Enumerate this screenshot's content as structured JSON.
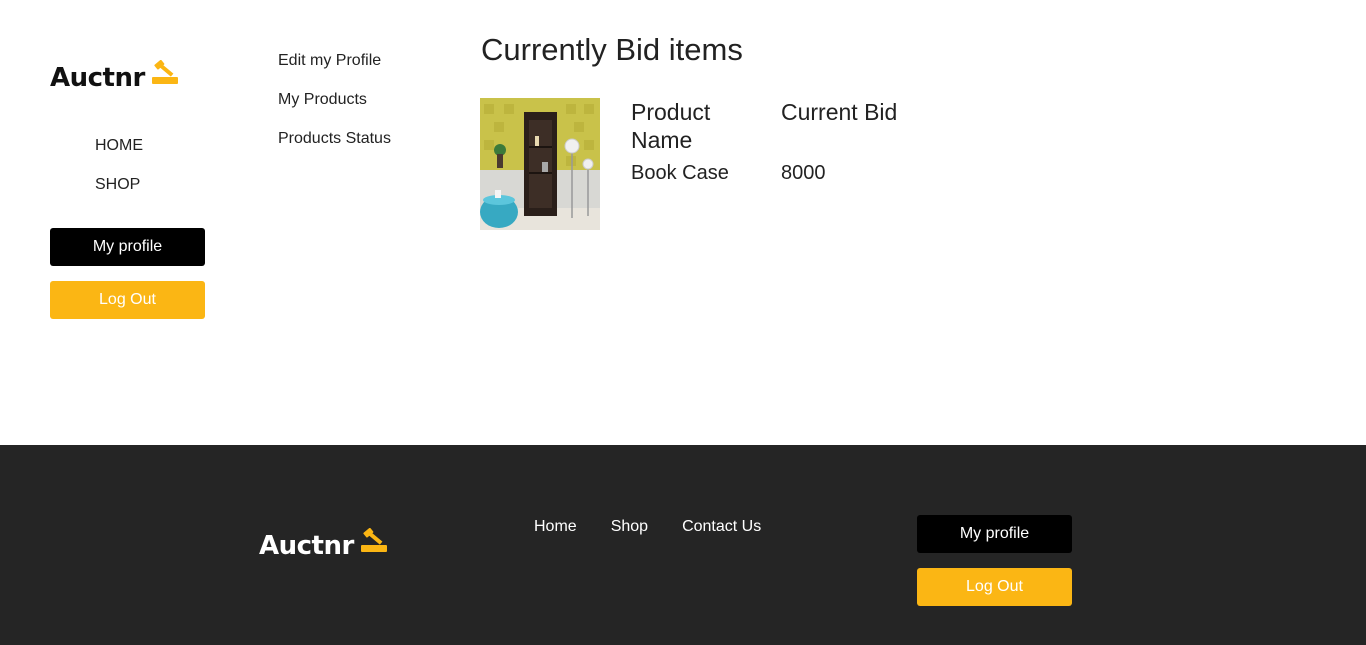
{
  "brand": {
    "name": "Auctnr",
    "accent": "#fbb614"
  },
  "nav": {
    "items": [
      {
        "label": "HOME"
      },
      {
        "label": "SHOP"
      }
    ]
  },
  "buttons": {
    "profile": "My profile",
    "logout": "Log Out"
  },
  "profile_menu": {
    "items": [
      {
        "label": "Edit my Profile"
      },
      {
        "label": "My Products"
      },
      {
        "label": "Products Status"
      }
    ]
  },
  "main": {
    "title": "Currently Bid items",
    "columns": [
      "Product Name",
      "Current Bid"
    ],
    "rows": [
      {
        "product_name": "Book Case",
        "current_bid": "8000",
        "image_icon": "bookcase-image"
      }
    ]
  },
  "footer": {
    "links": [
      {
        "label": "Home"
      },
      {
        "label": "Shop"
      },
      {
        "label": "Contact Us"
      }
    ],
    "profile": "My profile",
    "logout": "Log Out",
    "background": "#252525"
  }
}
